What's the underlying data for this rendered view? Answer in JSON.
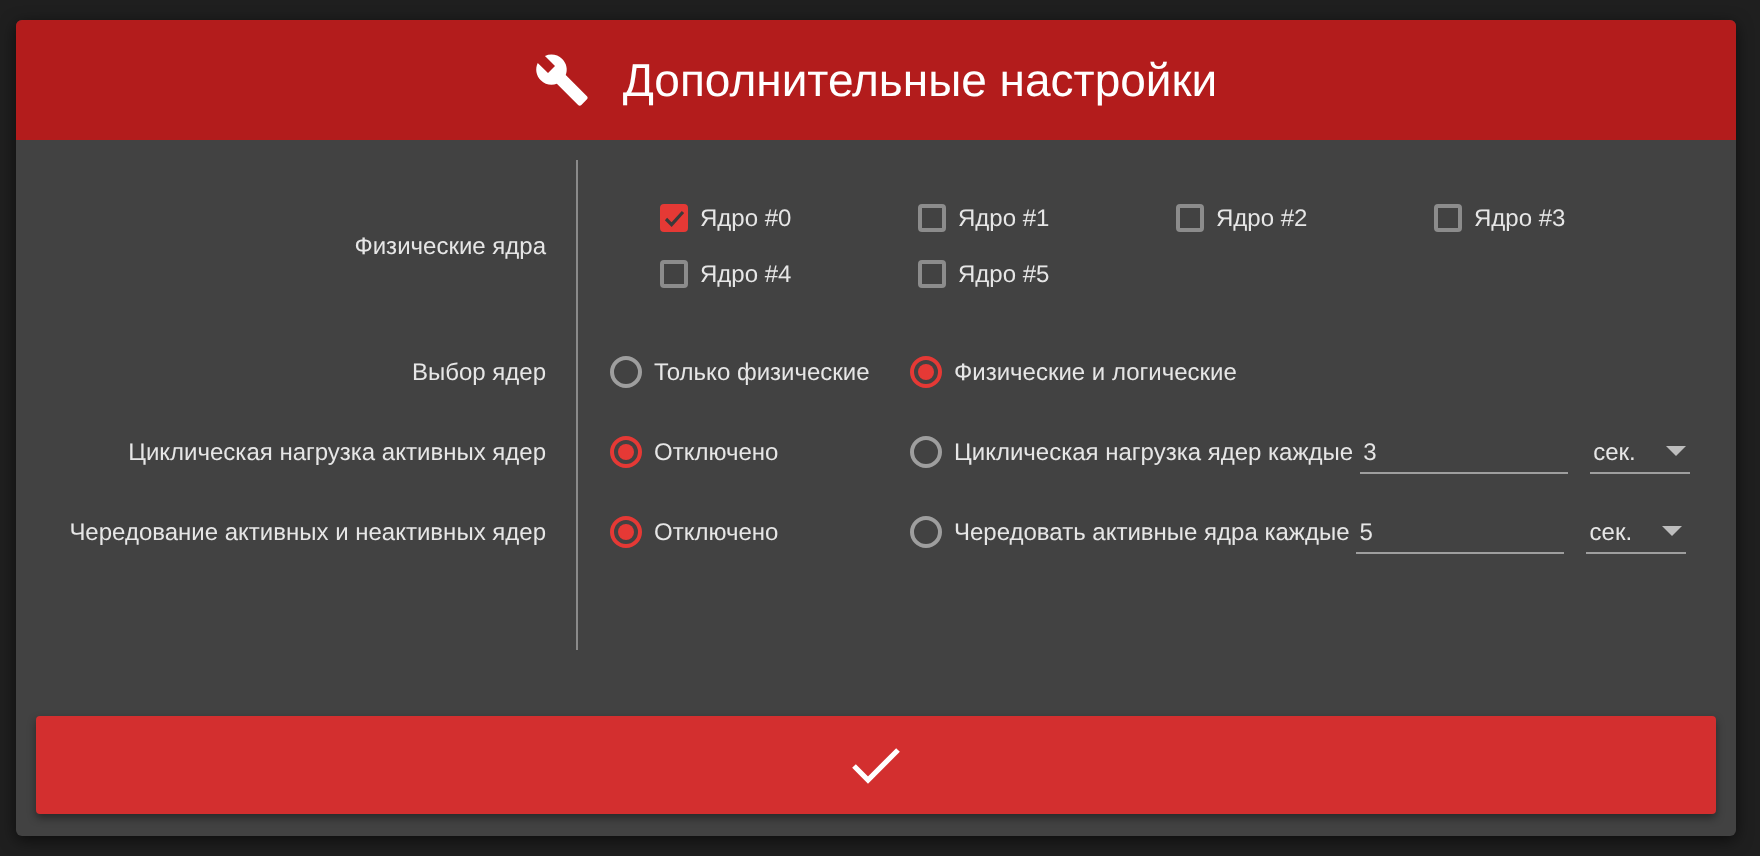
{
  "title": "Дополнительные настройки",
  "settings": [
    {
      "kind": "checkboxes",
      "label": "Физические ядра",
      "options": [
        {
          "label": "Ядро #0",
          "checked": true
        },
        {
          "label": "Ядро #1",
          "checked": false
        },
        {
          "label": "Ядро #2",
          "checked": false
        },
        {
          "label": "Ядро #3",
          "checked": false
        },
        {
          "label": "Ядро #4",
          "checked": false
        },
        {
          "label": "Ядро #5",
          "checked": false
        }
      ]
    },
    {
      "kind": "radios",
      "label": "Выбор ядер",
      "options": [
        {
          "label": "Только физические",
          "selected": false
        },
        {
          "label": "Физические и логические",
          "selected": true
        }
      ]
    },
    {
      "kind": "radios",
      "label": "Циклическая нагрузка активных ядер",
      "options": [
        {
          "label": "Отключено",
          "selected": true
        },
        {
          "label": "Циклическая нагрузка ядер каждые",
          "selected": false,
          "value": "3",
          "unit": "сек."
        }
      ]
    },
    {
      "kind": "radios",
      "label": "Чередование активных и неактивных ядер",
      "options": [
        {
          "label": "Отключено",
          "selected": true
        },
        {
          "label": "Чередовать активные ядра каждые",
          "selected": false,
          "value": "5",
          "unit": "сек."
        }
      ]
    }
  ]
}
